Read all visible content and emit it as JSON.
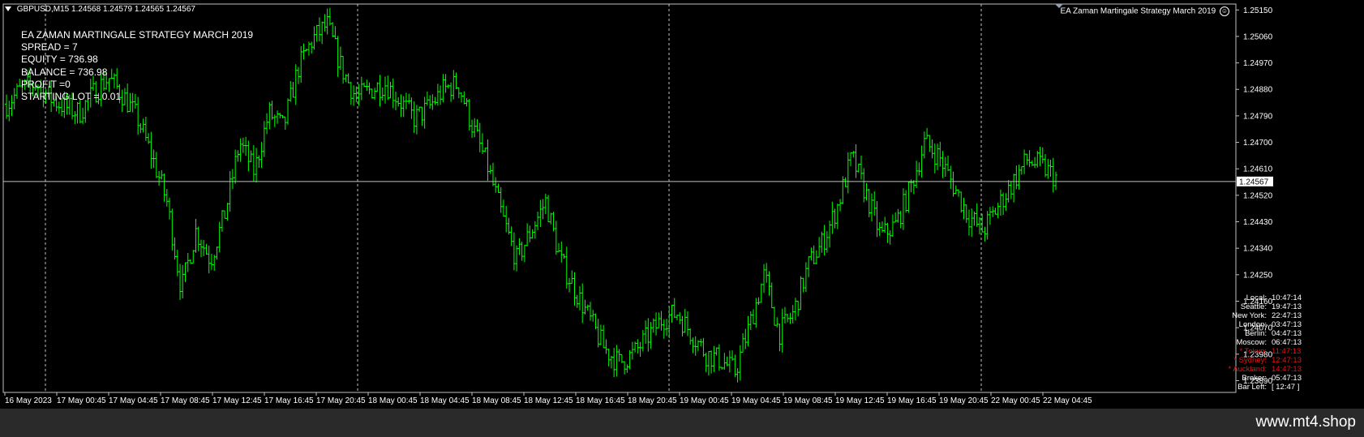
{
  "header": {
    "symbol_tf": "GBPUSD,M15",
    "quote": "1.24568 1.24579 1.24565 1.24567"
  },
  "ea_info": {
    "title": "EA ZAMAN MARTINGALE STRATEGY MARCH 2019",
    "lines": [
      "SPREAD = 7",
      "EQUITY = 736.98",
      "BALANCE = 736.98",
      "PROFIT =0",
      "STARTING LOT = 0.01"
    ]
  },
  "ea_name": "EA Zaman Martingale Strategy March 2019",
  "price_axis": {
    "labels": [
      "1.25150",
      "1.25060",
      "1.24970",
      "1.24880",
      "1.24790",
      "1.24700",
      "1.24610",
      "1.24520",
      "1.24430",
      "1.24340",
      "1.24250",
      "1.24160",
      "1.24070",
      "1.23980",
      "1.23890"
    ],
    "current_price": "1.24567",
    "current_value": 1.24567,
    "min": 1.2385,
    "max": 1.2517
  },
  "time_axis": {
    "labels": [
      "16 May 2023",
      "17 May 00:45",
      "17 May 04:45",
      "17 May 08:45",
      "17 May 12:45",
      "17 May 16:45",
      "17 May 20:45",
      "18 May 00:45",
      "18 May 04:45",
      "18 May 08:45",
      "18 May 12:45",
      "18 May 16:45",
      "18 May 20:45",
      "19 May 00:45",
      "19 May 04:45",
      "19 May 08:45",
      "19 May 12:45",
      "19 May 16:45",
      "19 May 20:45",
      "22 May 00:45",
      "22 May 04:45"
    ]
  },
  "clocks": [
    {
      "label": "Local:",
      "value": "10:47:14",
      "red": false
    },
    {
      "label": "Seattle:",
      "value": "19:47:13",
      "red": false
    },
    {
      "label": "New York:",
      "value": "22:47:13",
      "red": false
    },
    {
      "label": "London:",
      "value": "03:47:13",
      "red": false
    },
    {
      "label": "Berlin:",
      "value": "04:47:13",
      "red": false
    },
    {
      "label": "Moscow:",
      "value": "06:47:13",
      "red": false
    },
    {
      "label": "* Tokyo:",
      "value": "11:47:13",
      "red": true
    },
    {
      "label": "* Sydney:",
      "value": "12:47:13",
      "red": true
    },
    {
      "label": "* Auckland:",
      "value": "14:47:13",
      "red": true
    },
    {
      "label": "Broker:",
      "value": "05:47:13",
      "red": false
    },
    {
      "label": "Bar Left:",
      "value": "[ 12:47 ]",
      "red": false
    }
  ],
  "colors": {
    "bars": "#00ff00",
    "grid": "#c0c0c0",
    "background": "#000000",
    "text": "#ffffff",
    "clock_red": "#e31414",
    "footer": "#2a2a2a"
  },
  "chart_data": {
    "type": "bar",
    "series": [
      {
        "values": [
          1.2483,
          1.2488,
          1.249,
          1.2485,
          1.2482,
          1.248,
          1.2487,
          1.2492,
          1.2486,
          1.2478,
          1.2465,
          1.245,
          1.242,
          1.244,
          1.243,
          1.2446,
          1.247,
          1.246,
          1.248,
          1.2475,
          1.2495,
          1.2505,
          1.251,
          1.2495,
          1.2485,
          1.2488,
          1.249,
          1.2484,
          1.2478,
          1.2482,
          1.2488,
          1.249,
          1.2475,
          1.2462,
          1.2445,
          1.243,
          1.244,
          1.245,
          1.243,
          1.242,
          1.241,
          1.24,
          1.2395,
          1.2398,
          1.2404,
          1.241,
          1.2412,
          1.2405,
          1.2398,
          1.2396,
          1.2392,
          1.2408,
          1.2425,
          1.2405,
          1.2412,
          1.2428,
          1.2436,
          1.2448,
          1.2465,
          1.2452,
          1.2438,
          1.2442,
          1.2454,
          1.247,
          1.2465,
          1.2455,
          1.2445,
          1.244,
          1.2448,
          1.2456,
          1.2464,
          1.2462,
          1.2458
        ]
      }
    ],
    "x": [
      "16 May 2023",
      "17 May 00:45",
      "17 May 04:45",
      "17 May 08:45",
      "17 May 12:45",
      "17 May 16:45",
      "17 May 20:45",
      "18 May 00:45",
      "18 May 04:45",
      "18 May 08:45",
      "18 May 12:45",
      "18 May 16:45",
      "18 May 20:45",
      "19 May 00:45",
      "19 May 04:45",
      "19 May 08:45",
      "19 May 12:45",
      "19 May 16:45",
      "19 May 20:45",
      "22 May 00:45",
      "22 May 04:45"
    ],
    "ylim": [
      1.2385,
      1.2517
    ],
    "grid": "vertical dashed",
    "current_price": 1.24567
  }
}
